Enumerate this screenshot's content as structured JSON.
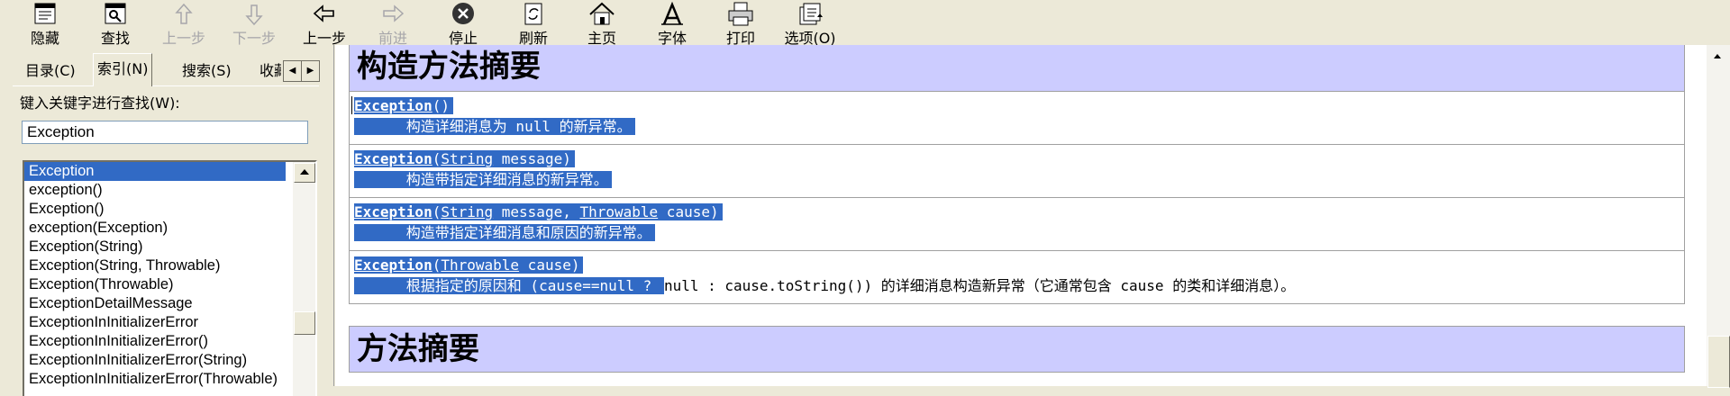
{
  "toolbar": {
    "buttons": [
      {
        "label": "隐藏",
        "icon": "hide-icon"
      },
      {
        "label": "查找",
        "icon": "find-icon"
      },
      {
        "label": "上一步",
        "icon": "up-arrow-icon"
      },
      {
        "label": "下一步",
        "icon": "down-arrow-icon"
      },
      {
        "label": "上一步",
        "icon": "back-icon"
      },
      {
        "label": "前进",
        "icon": "forward-icon"
      },
      {
        "label": "停止",
        "icon": "stop-icon"
      },
      {
        "label": "刷新",
        "icon": "refresh-icon"
      },
      {
        "label": "主页",
        "icon": "home-icon"
      },
      {
        "label": "字体",
        "icon": "font-icon"
      },
      {
        "label": "打印",
        "icon": "print-icon"
      },
      {
        "label": "选项(O)",
        "icon": "options-icon"
      }
    ]
  },
  "nav": {
    "tabs": [
      "目录(C)",
      "索引(N)",
      "搜索(S)",
      "收藏"
    ],
    "active_tab": "索引(N)",
    "keyword_label": "键入关键字进行查找(W):",
    "keyword_value": "Exception",
    "index_items": [
      "Exception",
      "exception()",
      "Exception()",
      "exception(Exception)",
      "Exception(String)",
      "Exception(String, Throwable)",
      "Exception(Throwable)",
      "ExceptionDetailMessage",
      "ExceptionInInitializerError",
      "ExceptionInInitializerError()",
      "ExceptionInInitializerError(String)",
      "ExceptionInInitializerError(Throwable)"
    ],
    "selected_index": 0
  },
  "content": {
    "constructor_heading": "构造方法摘要",
    "constructors": [
      {
        "name": "Exception",
        "sig_rest": "()",
        "desc": "构造详细消息为 null 的新异常。"
      },
      {
        "name": "Exception",
        "sig_open": "(",
        "type1": "String",
        "rest1": " message)",
        "desc": "构造带指定详细消息的新异常。"
      },
      {
        "name": "Exception",
        "sig_open": "(",
        "type1": "String",
        "rest1": " message, ",
        "type2": "Throwable",
        "rest2": " cause)",
        "desc": "构造带指定详细消息和原因的新异常。"
      },
      {
        "name": "Exception",
        "sig_open": "(",
        "type1": "Throwable",
        "rest1": " cause)",
        "desc_selected": "根据指定的原因和 (cause==null ? ",
        "desc_rest": "null : cause.toString()) 的详细消息构造新异常（它通常包含 cause 的类和详细消息）。"
      }
    ],
    "method_heading": "方法摘要"
  },
  "colors": {
    "selection": "#316ac5",
    "section_header": "#ccccff",
    "chrome": "#ece9d8"
  }
}
